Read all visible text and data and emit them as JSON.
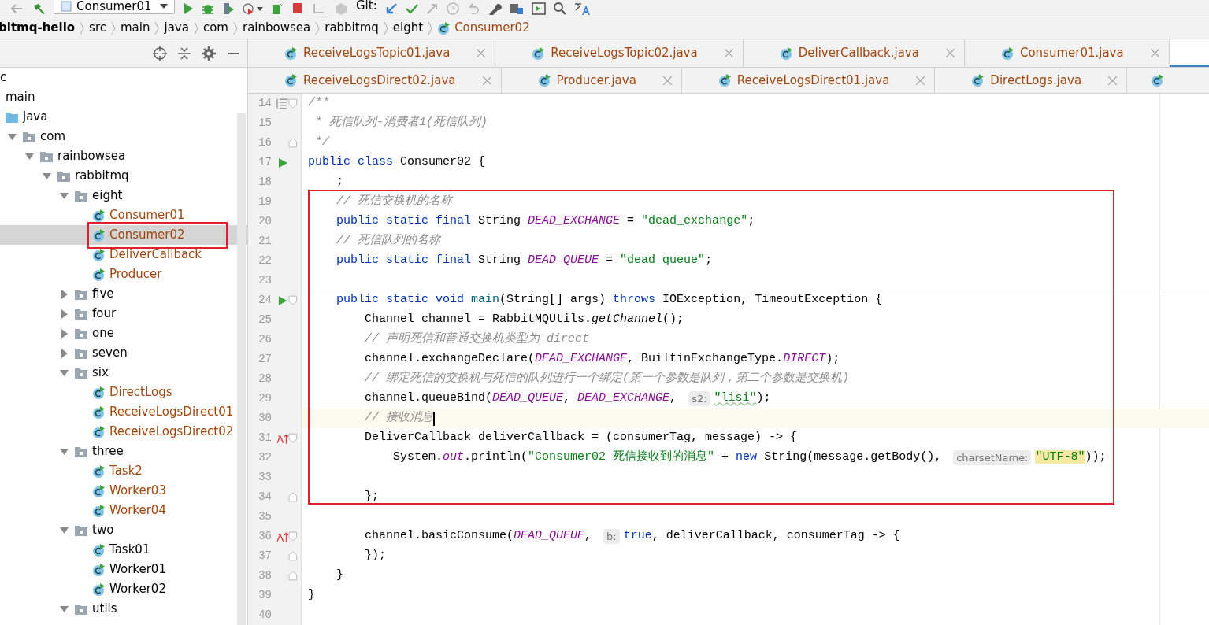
{
  "toolbar": {
    "run_config": "Consumer01",
    "vcs_label": "Git:"
  },
  "breadcrumb": [
    {
      "label": "bitmq-hello",
      "kind": "project"
    },
    {
      "label": "src",
      "kind": "dir"
    },
    {
      "label": "main",
      "kind": "dir"
    },
    {
      "label": "java",
      "kind": "dir"
    },
    {
      "label": "com",
      "kind": "dir"
    },
    {
      "label": "rainbowsea",
      "kind": "dir"
    },
    {
      "label": "rabbitmq",
      "kind": "dir"
    },
    {
      "label": "eight",
      "kind": "dir"
    },
    {
      "label": "Consumer02",
      "kind": "class"
    }
  ],
  "project_tree": [
    {
      "label": "c",
      "selected": false,
      "children": [
        {
          "label": "main",
          "selected": false,
          "children": [
            {
              "label": "java",
              "kind": "source-root",
              "selected": false,
              "children": [
                {
                  "label": "com",
                  "kind": "package",
                  "expanded": true,
                  "selected": false,
                  "children": [
                    {
                      "label": "rainbowsea",
                      "kind": "package",
                      "expanded": true,
                      "selected": false,
                      "children": [
                        {
                          "label": "rabbitmq",
                          "kind": "package",
                          "expanded": true,
                          "selected": false,
                          "children": [
                            {
                              "label": "eight",
                              "kind": "package",
                              "expanded": true,
                              "selected": false,
                              "children": [
                                {
                                  "label": "Consumer01",
                                  "kind": "class",
                                  "modified": true,
                                  "selected": false
                                },
                                {
                                  "label": "Consumer02",
                                  "kind": "class",
                                  "modified": true,
                                  "selected": true,
                                  "annotated": true
                                },
                                {
                                  "label": "DeliverCallback",
                                  "kind": "class",
                                  "modified": true,
                                  "selected": false
                                },
                                {
                                  "label": "Producer",
                                  "kind": "class",
                                  "modified": true,
                                  "selected": false
                                }
                              ]
                            },
                            {
                              "label": "five",
                              "kind": "package",
                              "expanded": false,
                              "selected": false
                            },
                            {
                              "label": "four",
                              "kind": "package",
                              "expanded": false,
                              "selected": false
                            },
                            {
                              "label": "one",
                              "kind": "package",
                              "expanded": false,
                              "selected": false
                            },
                            {
                              "label": "seven",
                              "kind": "package",
                              "expanded": false,
                              "selected": false
                            },
                            {
                              "label": "six",
                              "kind": "package",
                              "expanded": true,
                              "selected": false,
                              "children": [
                                {
                                  "label": "DirectLogs",
                                  "kind": "class",
                                  "modified": true,
                                  "selected": false
                                },
                                {
                                  "label": "ReceiveLogsDirect01",
                                  "kind": "class",
                                  "modified": true,
                                  "selected": false
                                },
                                {
                                  "label": "ReceiveLogsDirect02",
                                  "kind": "class",
                                  "modified": true,
                                  "selected": false
                                }
                              ]
                            },
                            {
                              "label": "three",
                              "kind": "package",
                              "expanded": true,
                              "selected": false,
                              "children": [
                                {
                                  "label": "Task2",
                                  "kind": "class",
                                  "modified": true,
                                  "selected": false
                                },
                                {
                                  "label": "Worker03",
                                  "kind": "class",
                                  "modified": true,
                                  "selected": false
                                },
                                {
                                  "label": "Worker04",
                                  "kind": "class",
                                  "modified": true,
                                  "selected": false
                                }
                              ]
                            },
                            {
                              "label": "two",
                              "kind": "package",
                              "expanded": true,
                              "selected": false,
                              "children": [
                                {
                                  "label": "Task01",
                                  "kind": "class",
                                  "modified": false,
                                  "selected": false
                                },
                                {
                                  "label": "Worker01",
                                  "kind": "class",
                                  "modified": false,
                                  "selected": false
                                },
                                {
                                  "label": "Worker02",
                                  "kind": "class",
                                  "modified": false,
                                  "selected": false
                                }
                              ]
                            },
                            {
                              "label": "utils",
                              "kind": "package",
                              "expanded": true,
                              "selected": false
                            }
                          ]
                        }
                      ]
                    }
                  ]
                }
              ]
            }
          ]
        }
      ]
    }
  ],
  "editor_tabs": [
    [
      {
        "label": "ReceiveLogsTopic01.java",
        "selected": false
      },
      {
        "label": "ReceiveLogsTopic02.java",
        "selected": false
      },
      {
        "label": "DeliverCallback.java",
        "selected": false
      },
      {
        "label": "Consumer01.java",
        "selected": false
      },
      {
        "selected": true
      }
    ],
    [
      {
        "label": "ReceiveLogsDirect02.java",
        "selected": false
      },
      {
        "label": "Producer.java",
        "selected": false
      },
      {
        "label": "ReceiveLogsDirect01.java",
        "selected": false
      },
      {
        "label": "DirectLogs.java",
        "selected": false
      },
      {
        "selected": false
      }
    ]
  ],
  "code_blocks": [
    {
      "lines": [
        {
          "number": "14",
          "doc_marker": true,
          "fold_start": true,
          "tokens": [
            {
              "kind": "comment",
              "text": "/**"
            }
          ]
        },
        {
          "number": "15",
          "tokens": [
            {
              "kind": "comment",
              "text": " * 死信队列-消费者1(死信队列)"
            }
          ]
        },
        {
          "number": "16",
          "fold_end": true,
          "tokens": [
            {
              "kind": "comment",
              "text": " */"
            }
          ]
        },
        {
          "number": "17",
          "run_marker": true,
          "tokens": [
            {
              "kind": "kw",
              "text": "public class"
            },
            {
              "kind": "plain",
              "text": " Consumer02 {"
            }
          ]
        },
        {
          "number": "18",
          "tokens": [
            {
              "kind": "plain",
              "text": "    ;"
            }
          ]
        }
      ]
    },
    {
      "annotated": true,
      "lines": [
        {
          "number": "19",
          "tokens": [
            {
              "kind": "comment",
              "text": "    // 死信交换机的名称"
            }
          ]
        },
        {
          "number": "20",
          "tokens": [
            {
              "kind": "kw",
              "text": "    public static final"
            },
            {
              "kind": "plain",
              "text": " String "
            },
            {
              "kind": "const",
              "text": "DEAD_EXCHANGE"
            },
            {
              "kind": "plain",
              "text": " = "
            },
            {
              "kind": "str",
              "text": "\"dead_exchange\""
            },
            {
              "kind": "plain",
              "text": ";"
            }
          ]
        },
        {
          "number": "21",
          "tokens": [
            {
              "kind": "comment",
              "text": "    // 死信队列的名称"
            }
          ]
        },
        {
          "number": "22",
          "tokens": [
            {
              "kind": "kw",
              "text": "    public static final"
            },
            {
              "kind": "plain",
              "text": " String "
            },
            {
              "kind": "const",
              "text": "DEAD_QUEUE"
            },
            {
              "kind": "plain",
              "text": " = "
            },
            {
              "kind": "str",
              "text": "\"dead_queue\""
            },
            {
              "kind": "plain",
              "text": ";"
            }
          ]
        },
        {
          "number": "23",
          "separator": true
        },
        {
          "number": "24",
          "run_marker": true,
          "fold_start": true,
          "tokens": [
            {
              "kind": "kw",
              "text": "    public static void"
            },
            {
              "kind": "decl",
              "text": " main"
            },
            {
              "kind": "plain",
              "text": "(String[] args) "
            },
            {
              "kind": "kw",
              "text": "throws"
            },
            {
              "kind": "plain",
              "text": " IOException, TimeoutException {"
            }
          ]
        },
        {
          "number": "25",
          "tokens": [
            {
              "kind": "plain",
              "text": "        Channel channel = RabbitMQUtils."
            },
            {
              "kind": "static-call",
              "text": "getChannel"
            },
            {
              "kind": "plain",
              "text": "();"
            }
          ]
        },
        {
          "number": "26",
          "tokens": [
            {
              "kind": "comment",
              "text": "        // 声明死信和普通交换机类型为 direct"
            }
          ]
        },
        {
          "number": "27",
          "tokens": [
            {
              "kind": "plain",
              "text": "        channel.exchangeDeclare("
            },
            {
              "kind": "const",
              "text": "DEAD_EXCHANGE"
            },
            {
              "kind": "plain",
              "text": ", BuiltinExchangeType."
            },
            {
              "kind": "const",
              "text": "DIRECT"
            },
            {
              "kind": "plain",
              "text": ");"
            }
          ]
        },
        {
          "number": "28",
          "tokens": [
            {
              "kind": "comment",
              "text": "        // 绑定死信的交换机与死信的队列进行一个绑定(第一个参数是队列，第二个参数是交换机)"
            }
          ]
        },
        {
          "number": "29",
          "tokens": [
            {
              "kind": "plain",
              "text": "        channel.queueBind("
            },
            {
              "kind": "const",
              "text": "DEAD_QUEUE"
            },
            {
              "kind": "plain",
              "text": ", "
            },
            {
              "kind": "const",
              "text": "DEAD_EXCHANGE"
            },
            {
              "kind": "plain",
              "text": ", "
            },
            {
              "kind": "hint",
              "text": "s2:"
            },
            {
              "kind": "str-typo",
              "text": "\"lisi\""
            },
            {
              "kind": "plain",
              "text": ");"
            }
          ]
        },
        {
          "number": "30",
          "current": true,
          "tokens": [
            {
              "kind": "comment",
              "text": "        // 接收消息"
            }
          ]
        },
        {
          "number": "31",
          "lambda_marker": true,
          "fold_start": true,
          "tokens": [
            {
              "kind": "plain",
              "text": "        DeliverCallback deliverCallback = (consumerTag, message) -> {"
            }
          ]
        },
        {
          "number": "32",
          "tokens": [
            {
              "kind": "plain",
              "text": "            System."
            },
            {
              "kind": "static-field",
              "text": "out"
            },
            {
              "kind": "plain",
              "text": ".println("
            },
            {
              "kind": "str",
              "text": "\"Consumer02 死信接收到的消息\""
            },
            {
              "kind": "plain",
              "text": " + "
            },
            {
              "kind": "kw",
              "text": "new"
            },
            {
              "kind": "plain",
              "text": " String(message.getBody(), "
            },
            {
              "kind": "hint",
              "text": "charsetName:"
            },
            {
              "kind": "str-match",
              "text": "\"UTF-8\""
            },
            {
              "kind": "plain",
              "text": "));"
            }
          ]
        },
        {
          "number": "33"
        },
        {
          "number": "34",
          "fold_end": true,
          "tokens": [
            {
              "kind": "plain",
              "text": "        };"
            }
          ]
        }
      ]
    },
    {
      "lines": [
        {
          "number": "35"
        },
        {
          "number": "36",
          "lambda_marker": true,
          "fold_start": true,
          "tokens": [
            {
              "kind": "plain",
              "text": "        channel.basicConsume("
            },
            {
              "kind": "const",
              "text": "DEAD_QUEUE"
            },
            {
              "kind": "plain",
              "text": ", "
            },
            {
              "kind": "hint",
              "text": "b:"
            },
            {
              "kind": "kw",
              "text": "true"
            },
            {
              "kind": "plain",
              "text": ", deliverCallback, consumerTag -> {"
            }
          ]
        },
        {
          "number": "37",
          "fold_end": true,
          "tokens": [
            {
              "kind": "plain",
              "text": "        });"
            }
          ]
        },
        {
          "number": "38",
          "fold_end": true,
          "tokens": [
            {
              "kind": "plain",
              "text": "    }"
            }
          ]
        },
        {
          "number": "39",
          "tokens": [
            {
              "kind": "plain",
              "text": "}"
            }
          ]
        },
        {
          "number": "40"
        }
      ]
    }
  ]
}
